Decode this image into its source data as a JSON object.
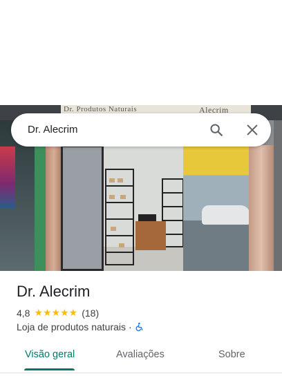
{
  "search": {
    "query": "Dr. Alecrim"
  },
  "photo": {
    "sign_left": "Dr. Produtos Naturais",
    "sign_right": "Alecrim"
  },
  "place": {
    "name": "Dr. Alecrim",
    "rating": "4,8",
    "stars": "★★★★★",
    "rating_value": 4.8,
    "review_count": "(18)",
    "category": "Loja de produtos naturais",
    "separator": "·",
    "accessibility_icon": "wheelchair-icon"
  },
  "tabs": [
    {
      "label": "Visão geral",
      "active": true
    },
    {
      "label": "Avaliações",
      "active": false
    },
    {
      "label": "Sobre",
      "active": false
    }
  ],
  "colors": {
    "accent": "#00796b",
    "star": "#fbbc04",
    "accessibility": "#1a73e8"
  }
}
